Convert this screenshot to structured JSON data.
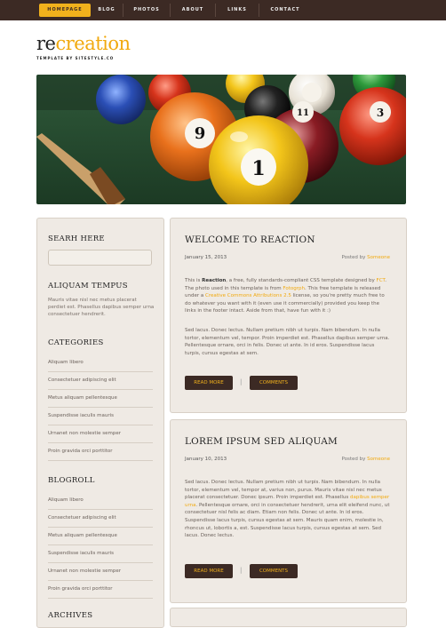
{
  "nav": {
    "items": [
      "HOMEPAGE",
      "BLOG",
      "PHOTOS",
      "ABOUT",
      "LINKS",
      "CONTACT"
    ]
  },
  "logo": {
    "part1": "re",
    "part2": "creation"
  },
  "tagline": "TEMPLATE BY SITESTYLE.CO",
  "sidebar": {
    "search_title": "SEARH HERE",
    "aliquam_title": "ALIQUAM TEMPUS",
    "aliquam_text": "Mauris vitae nisl nec metus placerat perdiet est. Phasellus dapibus semper urna consectetuer hendrerit.",
    "categories_title": "CATEGORIES",
    "categories": [
      "Aliquam libero",
      "Consectetuer adipiscing elit",
      "Metus aliquam pellentesque",
      "Suspendisse iaculis mauris",
      "Urnanet non molestie semper",
      "Proin gravida orci porttitor"
    ],
    "blogroll_title": "BLOGROLL",
    "blogroll": [
      "Aliquam libero",
      "Consectetuer adipiscing elit",
      "Metus aliquam pellentesque",
      "Suspendisse iaculis mauris",
      "Urnanet non molestie semper",
      "Proin gravida orci porttitor"
    ],
    "archives_title": "ARCHIVES"
  },
  "posts": [
    {
      "title": "WELCOME TO REACTION",
      "date": "January 15, 2013",
      "posted_by": "Posted by",
      "author": "Someone",
      "p1": {
        "a": "This is ",
        "b": "Reaction",
        "c": ", a free, fully standards-compliant CSS template designed by ",
        "d": "FCT",
        "e": ". The photo used in this template is from ",
        "f": "Fotogrph",
        "g": ". This free template is released under a ",
        "h": "Creative Commons Attributions 2.5",
        "i": " license, so you're pretty much free to do whatever you want with it (even use it commercially) provided you keep the links in the footer intact. Aside from that, have fun with it :)"
      },
      "p2": "Sed lacus. Donec lectus. Nullam pretium nibh ut turpis. Nam bibendum. In nulla tortor, elementum vel, tempor. Proin imperdiet est. Phasellus dapibus semper urna. Pellentesque ornare, orci in felis. Donec ut ante. In id eros. Suspendisse lacus turpis, cursus egestas at sem.",
      "read_more": "READ MORE",
      "comments": "COMMENTS",
      "sep": "|"
    },
    {
      "title": "LOREM IPSUM SED ALIQUAM",
      "date": "January 10, 2013",
      "posted_by": "Posted by",
      "author": "Someone",
      "p1": {
        "a": "Sed lacus. Donec lectus. Nullam pretium nibh ut turpis. Nam bibendum. In nulla tortor, elementum vel, tempor at, varius non, purus. Mauris vitae nisl nec metus placerat consectetuer. Donec ipsum. Proin imperdiet est. Phasellus ",
        "b": "dapibus semper urna",
        "c": ". Pellentesque ornare, orci in consectetuer hendrerit, urna elit eleifend nunc, ut consectetuer nisl felis ac diam. Etiam non felis. Donec ut ante. In id eros. Suspendisse lacus turpis, cursus egestas at sem. Mauris quam enim, molestie in, rhoncus ut, lobortis a, est. Suspendisse lacus turpis, cursus egestas at sem. Sed lacus. Donec lectus."
      },
      "read_more": "READ MORE",
      "comments": "COMMENTS",
      "sep": "|"
    }
  ],
  "colors": {
    "accent": "#f1b11c",
    "dark": "#3c2a24",
    "panel": "#efeae4"
  }
}
